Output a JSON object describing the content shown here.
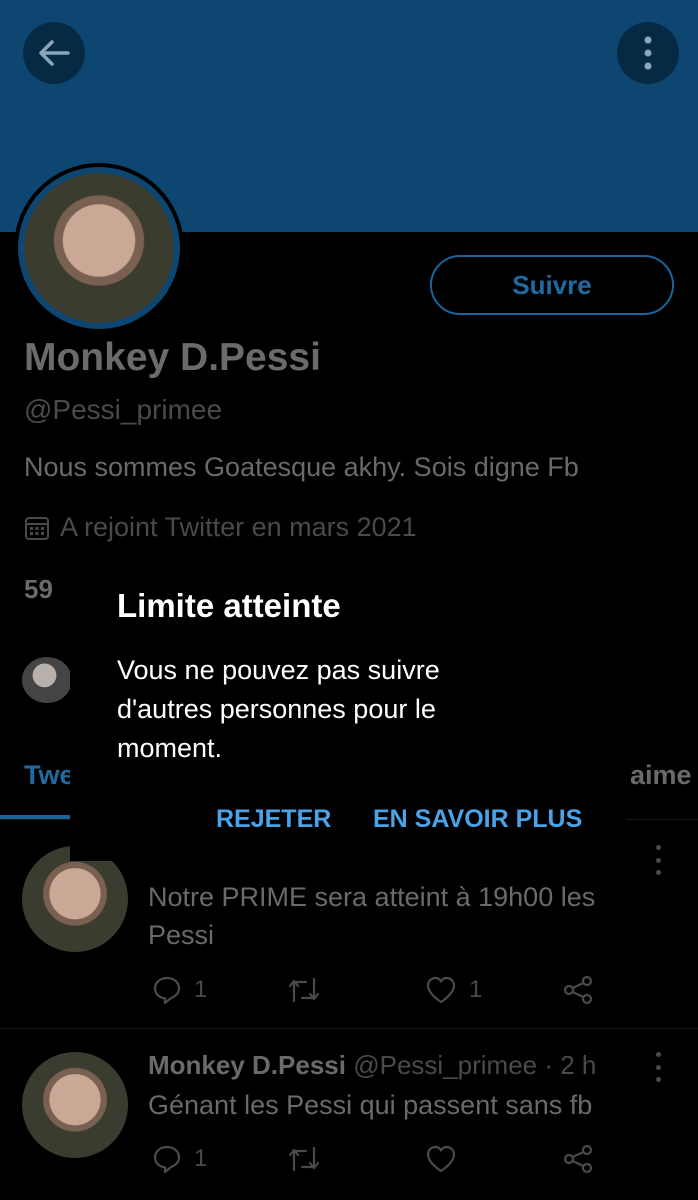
{
  "header": {
    "back_icon": "arrow-left-icon",
    "more_icon": "more-vertical-icon"
  },
  "profile": {
    "name": "Monkey D.Pessi",
    "handle": "@Pessi_primee",
    "bio": "Nous sommes Goatesque akhy. Sois digne Fb",
    "joined": "A rejoint Twitter en mars 2021",
    "follow_label": "Suivre",
    "stats_partial": "59"
  },
  "tabs": {
    "left_partial": "Twe",
    "right_partial": "aime"
  },
  "tweets": [
    {
      "text": "Notre PRIME sera atteint à 19h00 les Pessi",
      "replies": "1",
      "likes": "1"
    },
    {
      "author": "Monkey D.Pessi",
      "handle_time": "@Pessi_primee · 2 h",
      "text": "Génant les Pessi qui passent sans fb",
      "replies": "1"
    }
  ],
  "modal": {
    "title": "Limite atteinte",
    "message": "Vous ne pouvez pas suivre d'autres personnes pour le moment.",
    "reject_label": "REJETER",
    "learn_more_label": "EN SAVOIR PLUS"
  },
  "colors": {
    "banner": "#0d4670",
    "accent": "#1f6aa1",
    "modal_button": "#4aa3e8",
    "background": "#000000"
  }
}
